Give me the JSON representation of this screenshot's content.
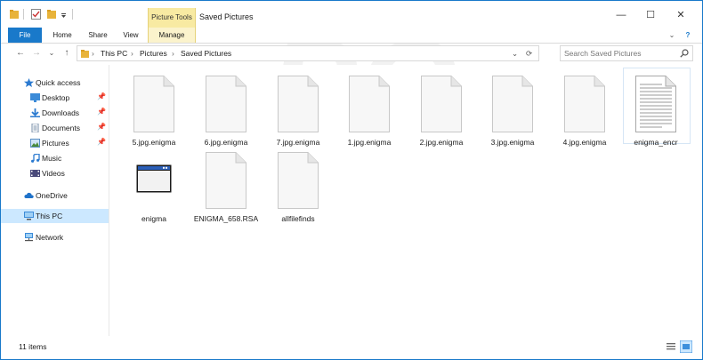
{
  "window": {
    "title": "Saved Pictures",
    "context_tab": "Picture Tools",
    "minimize_glyph": "—",
    "maximize_glyph": "☐",
    "close_glyph": "✕"
  },
  "ribbon": {
    "tabs": [
      "File",
      "Home",
      "Share",
      "View",
      "Manage"
    ],
    "help_glyph": "?",
    "expand_glyph": "⌄"
  },
  "address": {
    "back_glyph": "←",
    "forward_glyph": "→",
    "recent_glyph": "⌄",
    "up_glyph": "↑",
    "segments": [
      "This PC",
      "Pictures",
      "Saved Pictures"
    ],
    "separator": "›",
    "dropdown_glyph": "⌄",
    "refresh_glyph": "⟳"
  },
  "search": {
    "placeholder": "Search Saved Pictures"
  },
  "nav": {
    "quick_access": "Quick access",
    "items": [
      "Desktop",
      "Downloads",
      "Documents",
      "Pictures",
      "Music",
      "Videos"
    ],
    "pin_glyph": "📌",
    "onedrive": "OneDrive",
    "this_pc": "This PC",
    "network": "Network"
  },
  "files": [
    {
      "name": "5.jpg.enigma",
      "icon": "blank-document-icon"
    },
    {
      "name": "6.jpg.enigma",
      "icon": "blank-document-icon"
    },
    {
      "name": "7.jpg.enigma",
      "icon": "blank-document-icon"
    },
    {
      "name": "1.jpg.enigma",
      "icon": "blank-document-icon"
    },
    {
      "name": "2.jpg.enigma",
      "icon": "blank-document-icon"
    },
    {
      "name": "3.jpg.enigma",
      "icon": "blank-document-icon"
    },
    {
      "name": "4.jpg.enigma",
      "icon": "blank-document-icon"
    },
    {
      "name": "enigma_encr",
      "icon": "text-document-icon"
    },
    {
      "name": "enigma",
      "icon": "application-window-icon"
    },
    {
      "name": "ENIGMA_658.RSA",
      "icon": "blank-document-icon"
    },
    {
      "name": "allfilefinds",
      "icon": "blank-document-icon"
    }
  ],
  "status": {
    "item_count": "11 items"
  },
  "colors": {
    "accent": "#1979ca",
    "context_tab": "#f8eaa2",
    "selection": "#cce8ff"
  }
}
